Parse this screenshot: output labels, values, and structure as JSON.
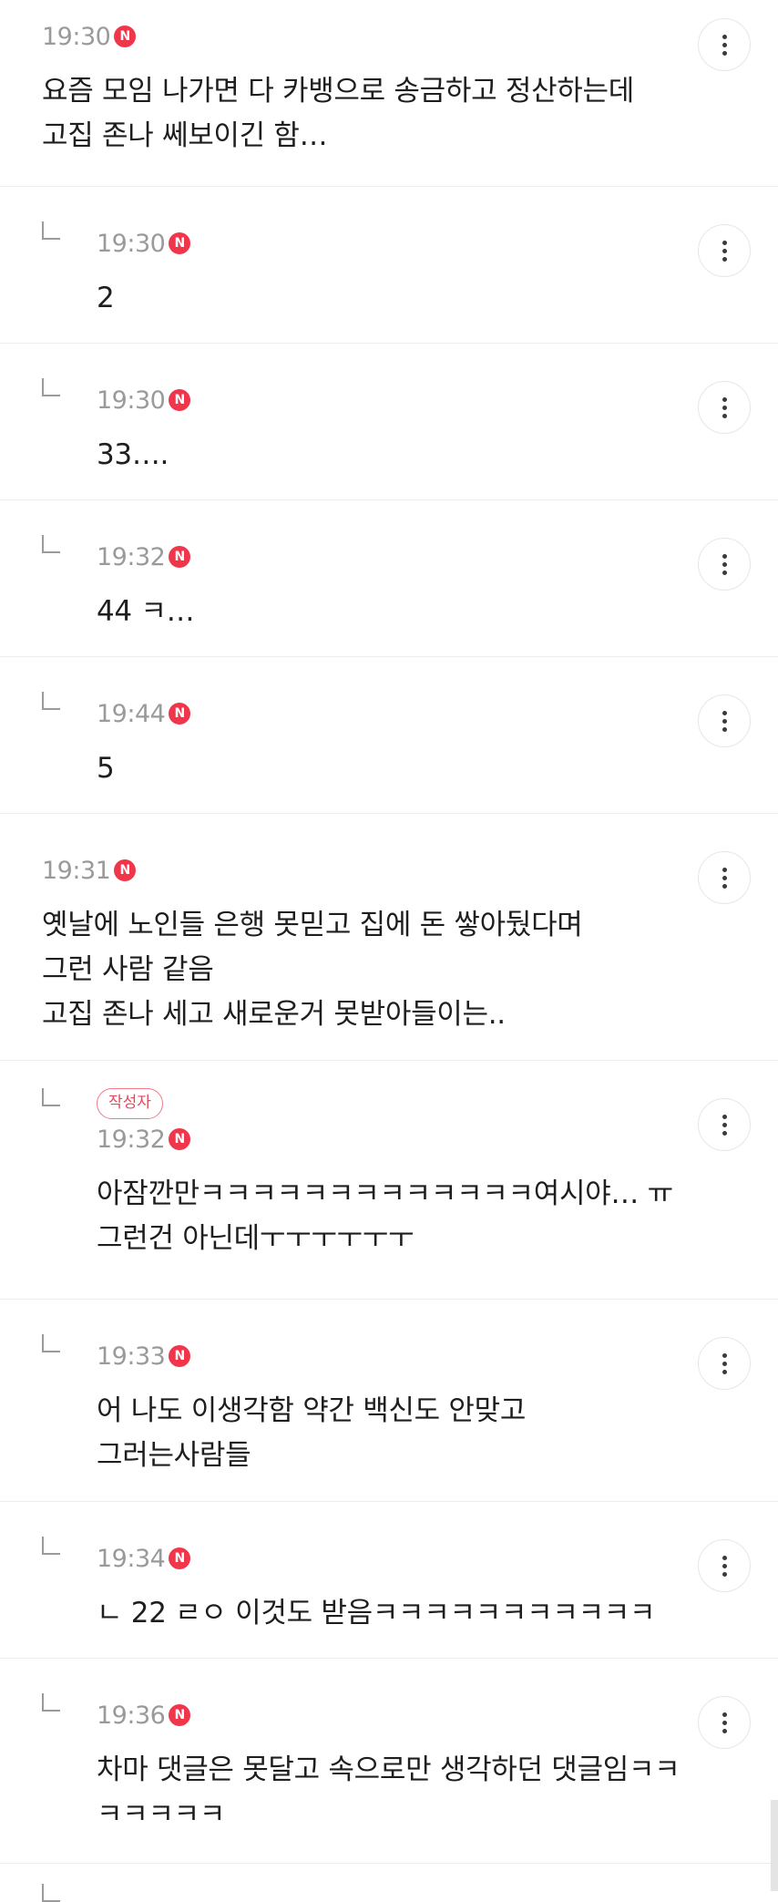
{
  "comments": [
    {
      "time": "19:30",
      "badge": "N",
      "text": "요즘 모임 나가면 다 카뱅으로 송금하고 정산하는데\n고집 존나 쎄보이긴 함…"
    },
    {
      "time": "19:30",
      "badge": "N",
      "text": "2"
    },
    {
      "time": "19:30",
      "badge": "N",
      "text": "33…."
    },
    {
      "time": "19:32",
      "badge": "N",
      "text": "44 ㅋ…"
    },
    {
      "time": "19:44",
      "badge": "N",
      "text": "5"
    },
    {
      "time": "19:31",
      "badge": "N",
      "text": "옛날에 노인들 은행 못믿고 집에 돈 쌓아뒀다며\n그런 사람 같음\n고집 존나 세고 새로운거 못받아들이는.."
    },
    {
      "author_label": "작성자",
      "time": "19:32",
      "badge": "N",
      "text": "아잠깐만ㅋㅋㅋㅋㅋㅋㅋㅋㅋㅋㅋㅋㅋ여시야… ㅠ\n그런건 아닌데ㅜㅜㅜㅜㅜㅜ"
    },
    {
      "time": "19:33",
      "badge": "N",
      "text": "어 나도 이생각함 약간 백신도 안맞고\n그러는사람들"
    },
    {
      "time": "19:34",
      "badge": "N",
      "text": "ㄴ 22 ㄹㅇ 이것도 받음ㅋㅋㅋㅋㅋㅋㅋㅋㅋㅋㅋ"
    },
    {
      "time": "19:36",
      "badge": "N",
      "text": "차마 댓글은 못달고 속으로만 생각하던 댓글임ㅋㅋ\nㅋㅋㅋㅋㅋ"
    }
  ],
  "icons": {
    "more": "more-vertical-icon",
    "reply": "reply-arrow-icon",
    "new": "new-badge-icon"
  },
  "colors": {
    "new_badge": "#f0364b",
    "author_badge": "#e8475a",
    "time": "#9a9a9a",
    "divider": "#ececec"
  }
}
